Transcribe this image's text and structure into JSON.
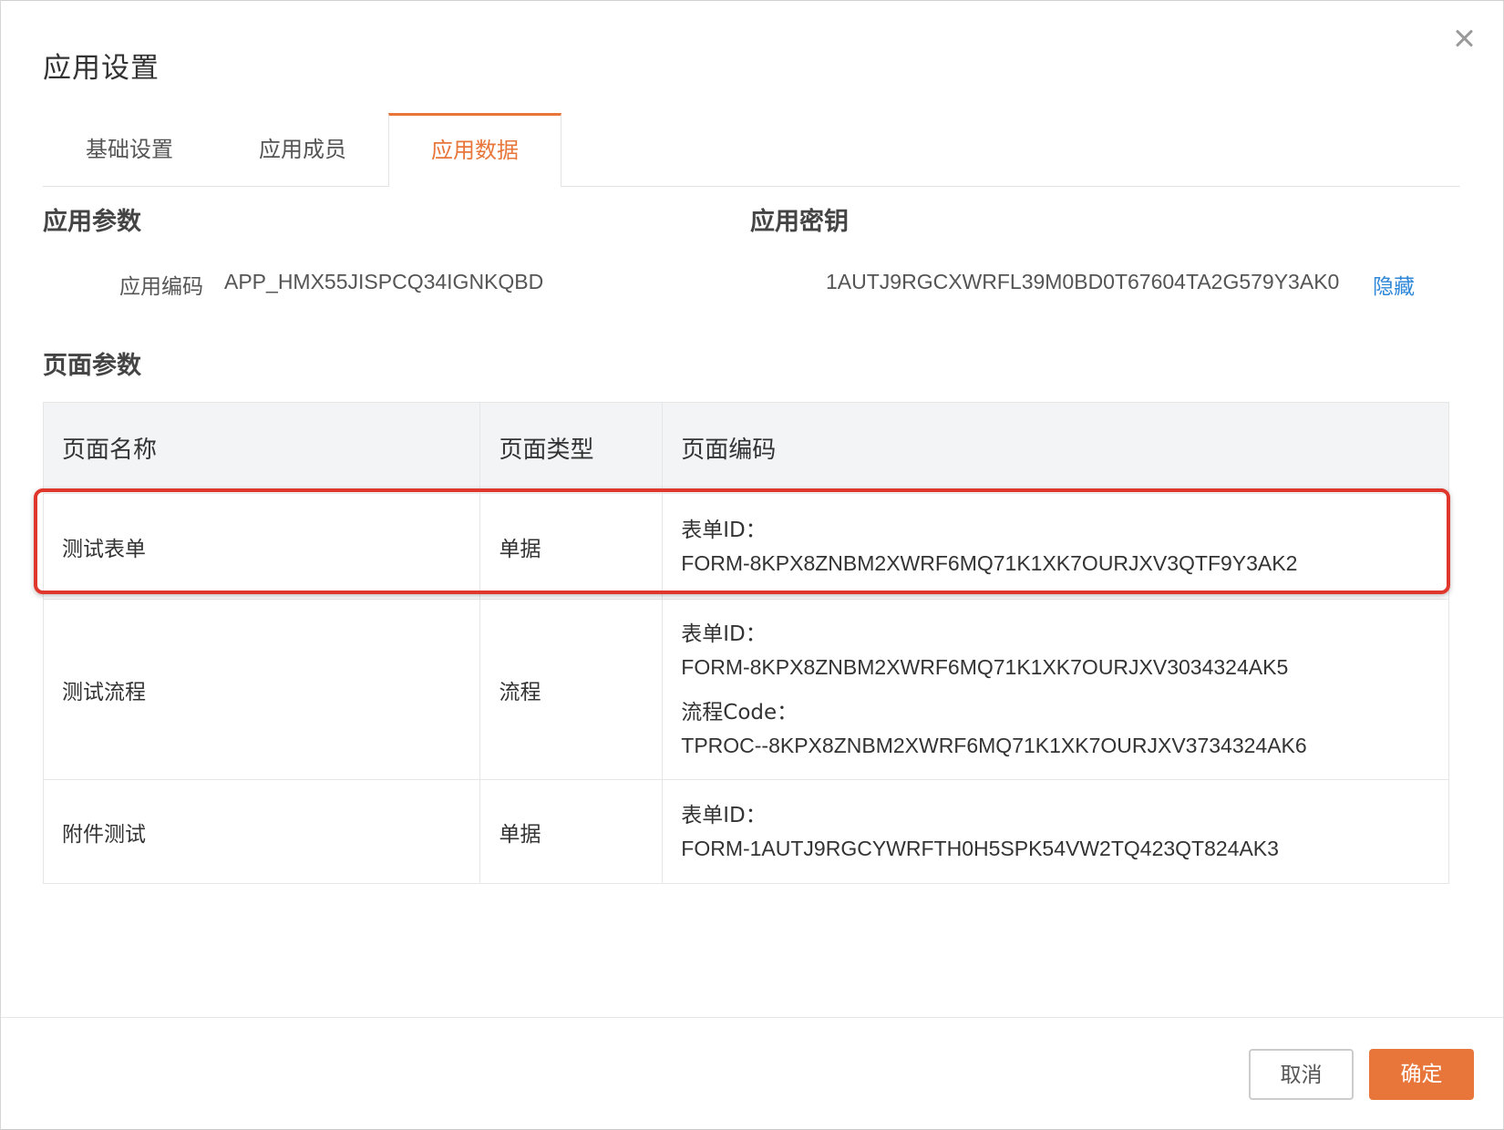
{
  "dialog": {
    "title": "应用设置"
  },
  "tabs": [
    {
      "label": "基础设置",
      "active": false
    },
    {
      "label": "应用成员",
      "active": false
    },
    {
      "label": "应用数据",
      "active": true
    }
  ],
  "app_params": {
    "title": "应用参数",
    "code_label": "应用编码",
    "code_value": "APP_HMX55JISPCQ34IGNKQBD"
  },
  "app_secret": {
    "title": "应用密钥",
    "value": "1AUTJ9RGCXWRFL39M0BD0T67604TA2G579Y3AK0",
    "hide_link": "隐藏"
  },
  "page_params": {
    "title": "页面参数",
    "columns": [
      "页面名称",
      "页面类型",
      "页面编码"
    ],
    "rows": [
      {
        "name": "测试表单",
        "type": "单据",
        "codes": [
          {
            "label": "表单ID：",
            "value": "FORM-8KPX8ZNBM2XWRF6MQ71K1XK7OURJXV3QTF9Y3AK2"
          }
        ]
      },
      {
        "name": "测试流程",
        "type": "流程",
        "codes": [
          {
            "label": "表单ID：",
            "value": "FORM-8KPX8ZNBM2XWRF6MQ71K1XK7OURJXV3034324AK5"
          },
          {
            "label": "流程Code：",
            "value": "TPROC--8KPX8ZNBM2XWRF6MQ71K1XK7OURJXV3734324AK6"
          }
        ]
      },
      {
        "name": "附件测试",
        "type": "单据",
        "codes": [
          {
            "label": "表单ID：",
            "value": "FORM-1AUTJ9RGCYWRFTH0H5SPK54VW2TQ423QT824AK3"
          }
        ]
      }
    ]
  },
  "footer": {
    "cancel_label": "取消",
    "ok_label": "确定"
  },
  "colors": {
    "accent": "#e8763b",
    "link": "#2f87d8",
    "highlight": "#e0372c"
  }
}
